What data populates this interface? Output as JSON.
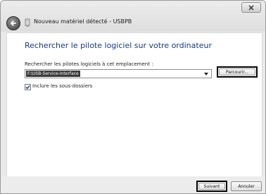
{
  "window": {
    "title": "Nouveau matériel détecté - USBPB"
  },
  "icons": {
    "close": "close-icon",
    "back": "back-arrow-icon",
    "device": "device-icon",
    "dropdown": "chevron-down-icon",
    "check": "checkmark-icon"
  },
  "main": {
    "heading": "Rechercher le pilote logiciel sur votre ordinateur",
    "search_label": "Rechercher les pilotes logiciels à cet emplacement :",
    "path_value": "F:\\USB-Service-Interface",
    "browse_label": "Parcourir...",
    "include_subfolders_label": "Inclure les sous-dossiers",
    "include_subfolders_checked": true
  },
  "footer": {
    "next_label": "Suivant",
    "cancel_label": "Annuler"
  },
  "colors": {
    "heading": "#1a3a7a",
    "selection": "#3a3a3a",
    "highlight_border": "#000000"
  }
}
